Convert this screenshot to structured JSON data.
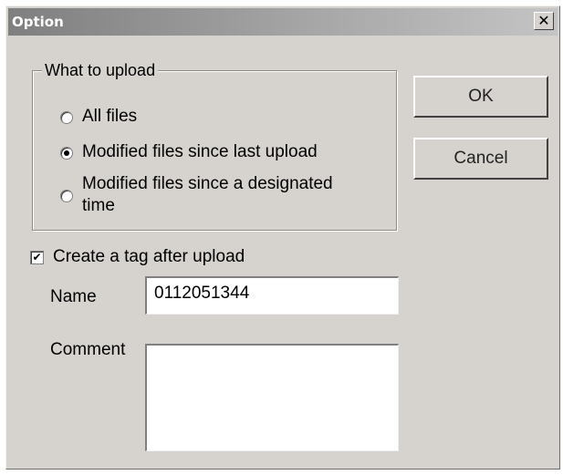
{
  "window": {
    "title": "Option",
    "close_glyph": "✕"
  },
  "upload_group": {
    "legend": "What to upload",
    "options": [
      {
        "label": "All files",
        "checked": false
      },
      {
        "label": "Modified files since last upload",
        "checked": true
      },
      {
        "label": "Modified files since a designated",
        "label_line2": "time",
        "checked": false
      }
    ]
  },
  "buttons": {
    "ok": "OK",
    "cancel": "Cancel"
  },
  "tag": {
    "checkbox_label": "Create a tag after upload",
    "checked": true,
    "check_glyph": "✔",
    "name_label": "Name",
    "name_value": "0112051344",
    "comment_label": "Comment",
    "comment_value": ""
  },
  "colors": {
    "dialog_bg": "#d6d3ce",
    "title_text": "#ffffff",
    "field_bg": "#ffffff"
  }
}
